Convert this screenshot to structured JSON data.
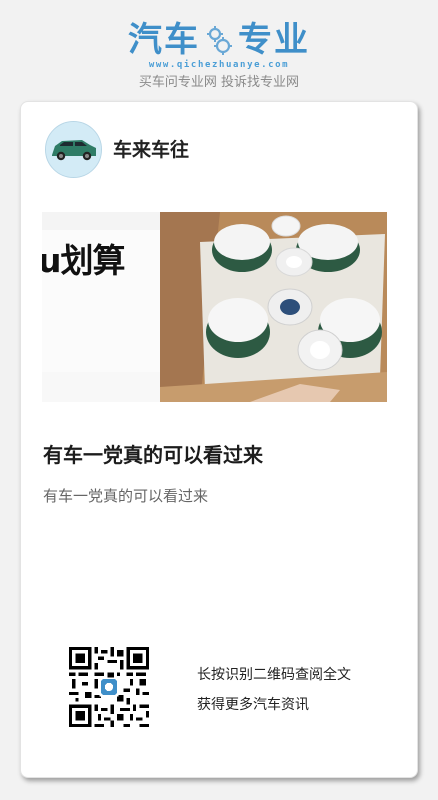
{
  "brand": {
    "name_left": "汽车",
    "name_right": "专业",
    "url": "www.qichezhuanye.com",
    "slogan": "买车问专业网 投诉找专业网",
    "color": "#3f8fc9"
  },
  "card": {
    "author": "车来车往",
    "image_overlay_text": "u划算",
    "title": "有车一党真的可以看过来",
    "subtitle": "有车一党真的可以看过来"
  },
  "footer": {
    "qr_hint_line1": "长按识别二维码查阅全文",
    "qr_hint_line2": "获得更多汽车资讯"
  },
  "icons": {
    "logo_gear": "gear-icon",
    "avatar": "car-avatar",
    "qr": "qr-code"
  }
}
